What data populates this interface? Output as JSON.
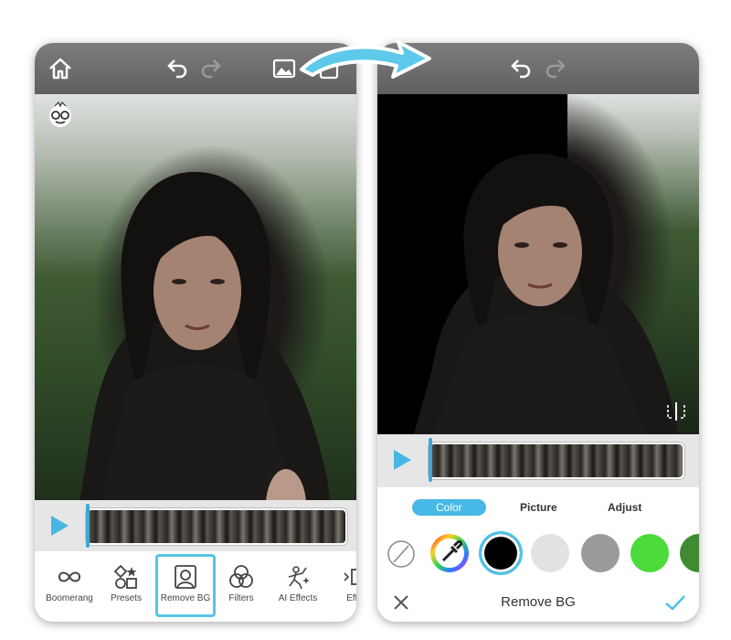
{
  "left_screen": {
    "top_icons": [
      "home-icon",
      "undo-icon",
      "redo-icon",
      "image-icon",
      "export-icon"
    ],
    "toolbar": {
      "items": [
        {
          "label": "Boomerang",
          "icon": "boomerang-icon"
        },
        {
          "label": "Presets",
          "icon": "presets-icon"
        },
        {
          "label": "Remove BG",
          "icon": "person-frame-icon",
          "selected": true
        },
        {
          "label": "Filters",
          "icon": "filters-icon"
        },
        {
          "label": "AI Effects",
          "icon": "ai-effects-icon"
        },
        {
          "label": "Effe",
          "icon": "effects-icon"
        }
      ]
    }
  },
  "right_screen": {
    "top_icons": [
      "undo-icon",
      "redo-icon"
    ],
    "tabs": [
      {
        "label": "Color",
        "active": true
      },
      {
        "label": "Picture",
        "active": false
      },
      {
        "label": "Adjust",
        "active": false
      }
    ],
    "swatches": [
      {
        "type": "none",
        "icon": "no-color-icon"
      },
      {
        "type": "picker",
        "icon": "color-picker-icon"
      },
      {
        "color": "#000000",
        "selected": true
      },
      {
        "color": "#e2e2e2"
      },
      {
        "color": "#9a9a9a"
      },
      {
        "color": "#4cdb3b"
      },
      {
        "color": "#3f8a33"
      }
    ],
    "bottom": {
      "title": "Remove BG",
      "cancel_icon": "close-icon",
      "confirm_icon": "check-icon"
    }
  },
  "colors": {
    "accent": "#48b6e4",
    "arrow": "#5ec9ea"
  }
}
